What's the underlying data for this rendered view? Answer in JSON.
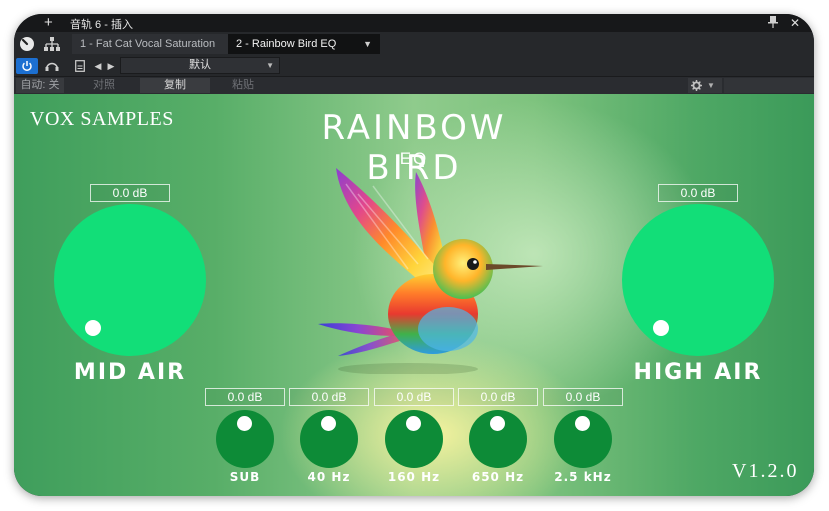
{
  "titlebar": {
    "add_symbol": "+",
    "title": "音轨 6 - 插入",
    "close_symbol": "✕"
  },
  "tabs": [
    {
      "label": "1 - Fat Cat Vocal Saturation"
    },
    {
      "label": "2 - Rainbow Bird EQ"
    }
  ],
  "preset": {
    "name": "默认"
  },
  "actions": {
    "auto": "自动: 关",
    "compare": "对照",
    "copy": "复制",
    "paste": "粘贴"
  },
  "plugin": {
    "brand": "VOX SAMPLES",
    "title": "RAINBOW BIRD",
    "subtitle": "EQ",
    "version": "V1.2.0",
    "knob_color": "#12de78",
    "small_knob_color": "#0d8b37",
    "big_knobs": [
      {
        "label": "MID AIR",
        "value": "0.0 dB"
      },
      {
        "label": "HIGH AIR",
        "value": "0.0 dB"
      }
    ],
    "bands": [
      {
        "label": "SUB",
        "value": "0.0 dB"
      },
      {
        "label": "40 Hz",
        "value": "0.0 dB"
      },
      {
        "label": "160 Hz",
        "value": "0.0 dB"
      },
      {
        "label": "650 Hz",
        "value": "0.0 dB"
      },
      {
        "label": "2.5 kHz",
        "value": "0.0 dB"
      }
    ]
  }
}
